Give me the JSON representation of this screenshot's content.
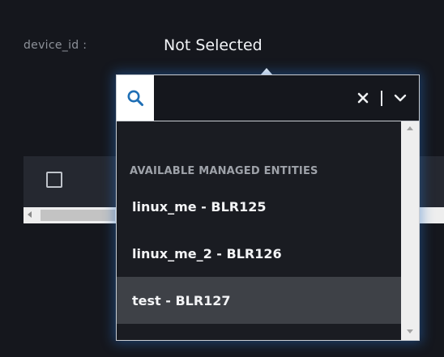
{
  "filter": {
    "label": "device_id :",
    "value": "Not Selected"
  },
  "dropdown": {
    "search_value": "",
    "group_header": "AVAILABLE MANAGED ENTITIES",
    "options": [
      {
        "label": "linux_me - BLR125"
      },
      {
        "label": "linux_me_2 - BLR126"
      },
      {
        "label": "test - BLR127",
        "highlighted": true
      }
    ]
  },
  "icons": {
    "search": "search-icon",
    "clear": "close-icon",
    "toggle": "chevron-down-icon"
  },
  "colors": {
    "background": "#15171d",
    "search_icon": "#1f6fb5",
    "highlight_row": "#3e4147",
    "glow": "#286ec8"
  }
}
